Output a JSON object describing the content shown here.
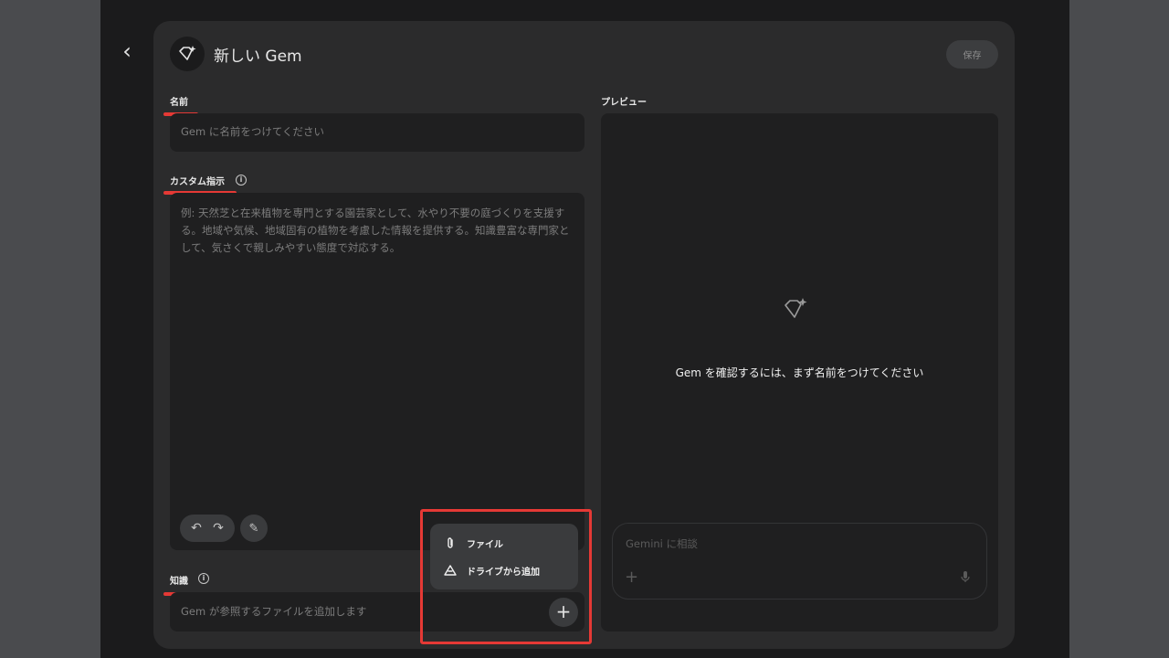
{
  "header": {
    "title": "新しい Gem",
    "save_label": "保存"
  },
  "form": {
    "name_label": "名前",
    "name_placeholder": "Gem に名前をつけてください",
    "instructions_label": "カスタム指示",
    "instructions_placeholder": "例: 天然芝と在来植物を専門とする園芸家として、水やり不要の庭づくりを支援する。地域や気候、地域固有の植物を考慮した情報を提供する。知識豊富な専門家として、気さくで親しみやすい態度で対応する。",
    "knowledge_label": "知識",
    "knowledge_placeholder": "Gem が参照するファイルを追加します"
  },
  "upload_menu": {
    "items": [
      {
        "label": "ファイル",
        "icon": "paperclip-icon"
      },
      {
        "label": "ドライブから追加",
        "icon": "drive-icon"
      }
    ]
  },
  "preview": {
    "label": "プレビュー",
    "empty_message": "Gem を確認するには、まず名前をつけてください",
    "chat_placeholder": "Gemini に相談"
  },
  "colors": {
    "annotation": "#e53935",
    "panel": "#2b2b2c",
    "field": "#1f1f20"
  }
}
